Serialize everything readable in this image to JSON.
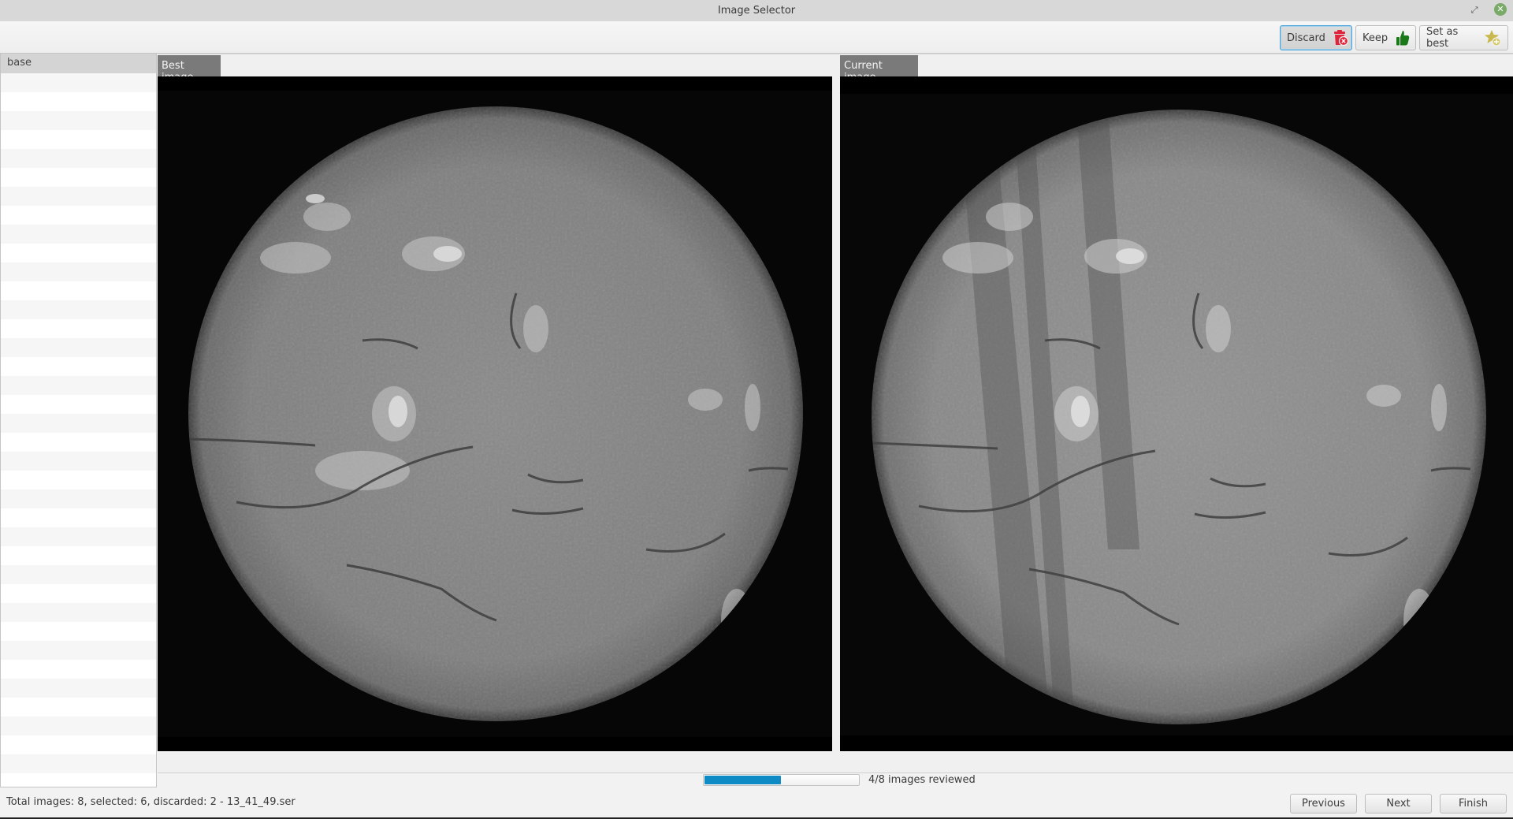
{
  "window": {
    "title": "Image Selector",
    "restore_icon": "restore-icon",
    "close_icon": "close-icon"
  },
  "toolbar": {
    "discard": {
      "label": "Discard",
      "icon": "trash-x-icon",
      "color": "#e0243c"
    },
    "keep": {
      "label": "Keep",
      "icon": "thumbs-up-icon",
      "color": "#1a7a1a"
    },
    "set_best": {
      "label": "Set as best",
      "icon": "star-plus-icon",
      "color": "#c8b84e"
    }
  },
  "sidebar": {
    "header": "base",
    "rows": 37
  },
  "panels": {
    "best": {
      "label": "Best image"
    },
    "current": {
      "label": "Current image"
    }
  },
  "progress": {
    "reviewed": 4,
    "total": 8,
    "fraction": 0.5,
    "text": "4/8 images reviewed",
    "color": "#0e8ac4"
  },
  "status": {
    "text": "Total images: 8, selected: 6, discarded: 2 - 13_41_49.ser"
  },
  "nav": {
    "previous": "Previous",
    "next": "Next",
    "finish": "Finish"
  }
}
